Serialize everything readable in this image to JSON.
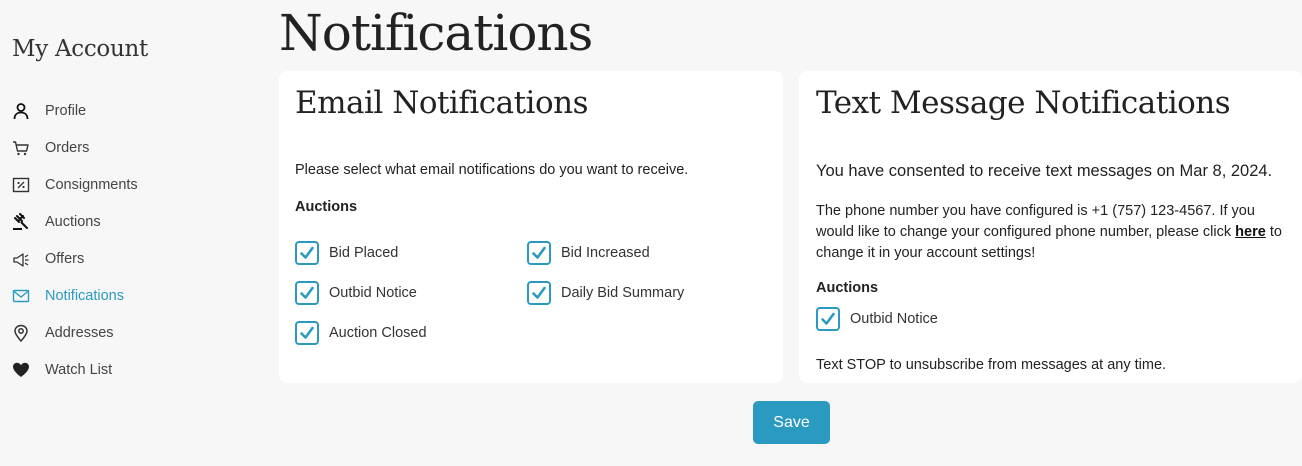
{
  "sidebar": {
    "title": "My Account",
    "items": [
      {
        "label": "Profile",
        "icon": "user-icon"
      },
      {
        "label": "Orders",
        "icon": "cart-icon"
      },
      {
        "label": "Consignments",
        "icon": "consignment-icon"
      },
      {
        "label": "Auctions",
        "icon": "gavel-icon"
      },
      {
        "label": "Offers",
        "icon": "megaphone-icon"
      },
      {
        "label": "Notifications",
        "icon": "envelope-icon",
        "active": true
      },
      {
        "label": "Addresses",
        "icon": "map-pin-icon"
      },
      {
        "label": "Watch List",
        "icon": "heart-icon"
      }
    ]
  },
  "page": {
    "title": "Notifications"
  },
  "email": {
    "title": "Email Notifications",
    "intro": "Please select what email notifications do you want to receive.",
    "section": "Auctions",
    "options": [
      {
        "label": "Bid Placed",
        "checked": true
      },
      {
        "label": "Bid Increased",
        "checked": true
      },
      {
        "label": "Outbid Notice",
        "checked": true
      },
      {
        "label": "Daily Bid Summary",
        "checked": true
      },
      {
        "label": "Auction Closed",
        "checked": true
      }
    ]
  },
  "sms": {
    "title": "Text Message Notifications",
    "consent": "You have consented to receive text messages on Mar 8, 2024.",
    "phone_text": "The phone number you have configured is +1 (757) 123-4567. If you would like to change your configured phone number, please click",
    "link_text": "here",
    "phone_text_after": "to change it in your account settings!",
    "section": "Auctions",
    "options": [
      {
        "label": "Outbid Notice",
        "checked": true
      }
    ],
    "stop_text": "Text STOP to unsubscribe from messages at any time."
  },
  "actions": {
    "save_label": "Save"
  },
  "colors": {
    "accent": "#2b9ac0",
    "background": "#f7f7f7",
    "card": "#ffffff"
  }
}
